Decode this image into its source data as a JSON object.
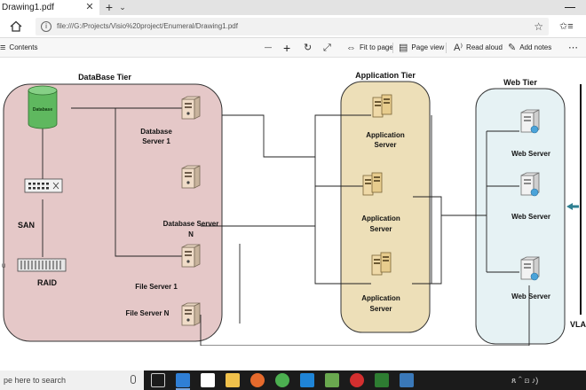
{
  "browser": {
    "tab_title": "Drawing1.pdf",
    "tab_close": "✕",
    "new_tab": "+",
    "tab_menu": "⌄",
    "url": "file:///G:/Projects/Visio%20project/Enumeral/Drawing1.pdf",
    "star": "☆",
    "hub": "✩≡"
  },
  "pdf_toolbar": {
    "contents": "Contents",
    "zoom_out": "—",
    "zoom_in": "+",
    "fit_to_page": "Fit to page",
    "page_view": "Page view",
    "read_aloud": "Read aloud",
    "add_notes": "Add notes"
  },
  "diagram": {
    "database_tier": "DataBase Tier",
    "application_tier": "Application Tier",
    "web_tier": "Web Tier",
    "database_cylinder": "Database",
    "san": "SAN",
    "raid": "RAID",
    "raid_side": "U",
    "db_server_1_line1": "Database",
    "db_server_1_line2": "Server 1",
    "db_server_n_line1": "Database Server",
    "db_server_n_line2": "N",
    "file_server_1": "File Server 1",
    "file_server_n": "File Server N",
    "app_server_line1": "Application",
    "app_server_line2": "Server",
    "web_server": "Web Server",
    "vlan": "VLA",
    "colors": {
      "db_tier_fill": "#e5c8c8",
      "app_tier_fill": "#eddfb8",
      "web_tier_fill": "#e6f2f4",
      "cylinder": "#5fb85f",
      "arrow": "#2e7f91"
    }
  },
  "taskbar": {
    "search_placeholder": "pe here to search",
    "tray_icons": "ጸ ⌃ ⊡ ♪)"
  }
}
